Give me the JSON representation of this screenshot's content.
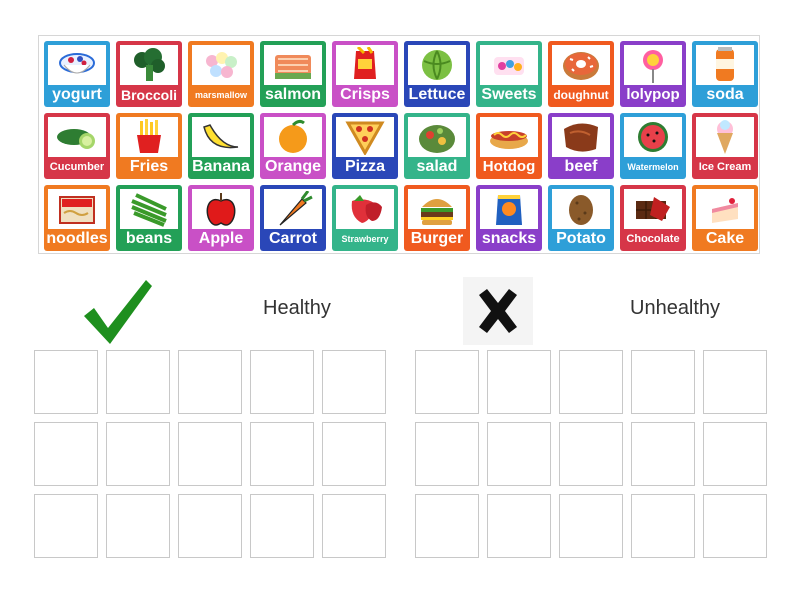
{
  "tray": {
    "items": [
      {
        "label": "yogurt",
        "icon": "yogurt-icon",
        "color": "#2e9fd8"
      },
      {
        "label": "Broccoli",
        "icon": "broccoli-icon",
        "color": "#d63648"
      },
      {
        "label": "marsmallow",
        "icon": "marshmallow-icon",
        "color": "#f07a21"
      },
      {
        "label": "salmon",
        "icon": "salmon-icon",
        "color": "#23a057"
      },
      {
        "label": "Crisps",
        "icon": "crisps-icon",
        "color": "#c950c6"
      },
      {
        "label": "Lettuce",
        "icon": "lettuce-icon",
        "color": "#2a47b8"
      },
      {
        "label": "Sweets",
        "icon": "sweets-icon",
        "color": "#34b48a"
      },
      {
        "label": "doughnut",
        "icon": "doughnut-icon",
        "color": "#f05a1f"
      },
      {
        "label": "lolypop",
        "icon": "lollipop-icon",
        "color": "#8a3ec9"
      },
      {
        "label": "soda",
        "icon": "soda-icon",
        "color": "#2e9fd8"
      },
      {
        "label": "Cucumber",
        "icon": "cucumber-icon",
        "color": "#d63648"
      },
      {
        "label": "Fries",
        "icon": "fries-icon",
        "color": "#f07a21"
      },
      {
        "label": "Banana",
        "icon": "banana-icon",
        "color": "#23a057"
      },
      {
        "label": "Orange",
        "icon": "orange-icon",
        "color": "#c950c6"
      },
      {
        "label": "Pizza",
        "icon": "pizza-icon",
        "color": "#2a47b8"
      },
      {
        "label": "salad",
        "icon": "salad-icon",
        "color": "#34b48a"
      },
      {
        "label": "Hotdog",
        "icon": "hotdog-icon",
        "color": "#f05a1f"
      },
      {
        "label": "beef",
        "icon": "beef-icon",
        "color": "#8a3ec9"
      },
      {
        "label": "Watermelon",
        "icon": "watermelon-icon",
        "color": "#2e9fd8"
      },
      {
        "label": "Ice Cream",
        "icon": "ice-cream-icon",
        "color": "#d63648"
      },
      {
        "label": "noodles",
        "icon": "noodles-icon",
        "color": "#f07a21"
      },
      {
        "label": "beans",
        "icon": "green-beans-icon",
        "color": "#23a057"
      },
      {
        "label": "Apple",
        "icon": "apple-icon",
        "color": "#c950c6"
      },
      {
        "label": "Carrot",
        "icon": "carrot-icon",
        "color": "#2a47b8"
      },
      {
        "label": "Strawberry",
        "icon": "strawberry-icon",
        "color": "#34b48a"
      },
      {
        "label": "Burger",
        "icon": "burger-icon",
        "color": "#f05a1f"
      },
      {
        "label": "snacks",
        "icon": "snacks-bag-icon",
        "color": "#8a3ec9"
      },
      {
        "label": "Potato",
        "icon": "potato-icon",
        "color": "#2e9fd8"
      },
      {
        "label": "Chocolate",
        "icon": "chocolate-icon",
        "color": "#d63648"
      },
      {
        "label": "Cake",
        "icon": "cake-icon",
        "color": "#f07a21"
      }
    ]
  },
  "groups": {
    "healthy": {
      "heading": "Healthy",
      "icon": "checkmark-icon",
      "color": "#1e8f1e"
    },
    "unhealthy": {
      "heading": "Unhealthy",
      "icon": "cross-icon",
      "color": "#111111"
    }
  }
}
